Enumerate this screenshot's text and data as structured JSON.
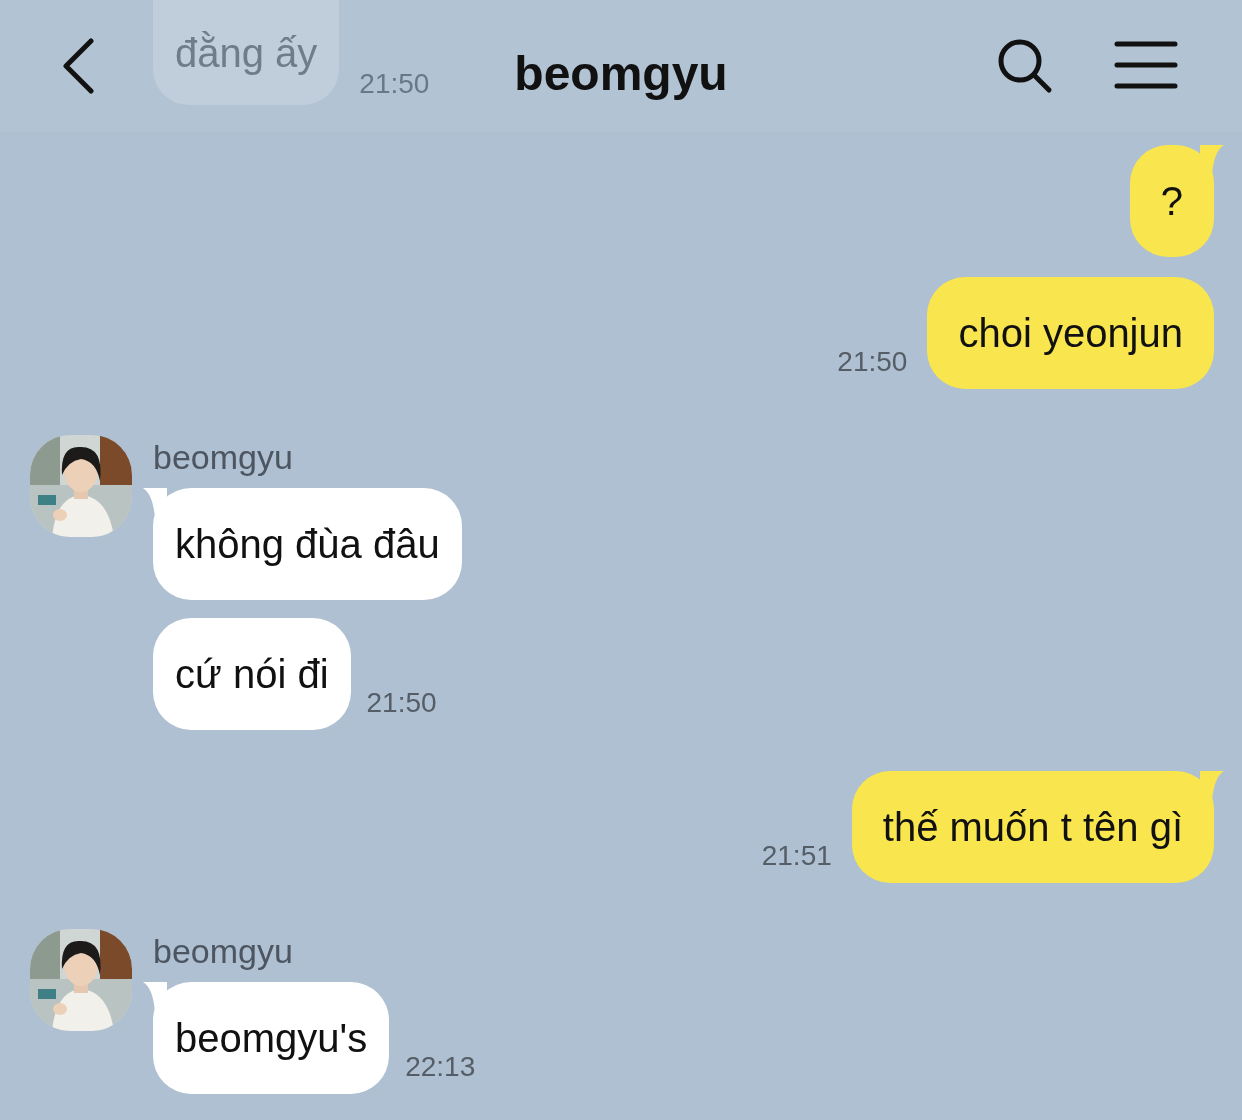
{
  "header": {
    "title": "beomgyu"
  },
  "faded_message": {
    "text": "đằng ấy",
    "time": "21:50"
  },
  "groups": [
    {
      "kind": "sent",
      "bubbles": [
        "?",
        "choi yeonjun"
      ],
      "time": "21:50"
    },
    {
      "kind": "received",
      "sender": "beomgyu",
      "avatar": {
        "kind": "picture"
      },
      "bubbles": [
        "không đùa đâu",
        "cứ nói đi"
      ],
      "time": "21:50"
    },
    {
      "kind": "sent",
      "bubbles": [
        "thế muốn t tên gì"
      ],
      "time": "21:51"
    },
    {
      "kind": "received",
      "sender": "beomgyu",
      "avatar": {
        "kind": "picture"
      },
      "bubbles": [
        "beomgyu's"
      ],
      "time": "22:13"
    }
  ]
}
